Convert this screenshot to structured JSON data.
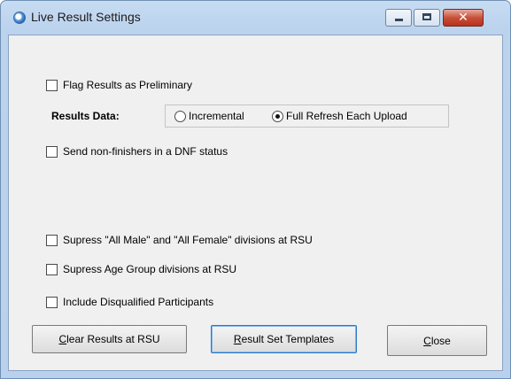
{
  "window": {
    "title": "Live Result Settings",
    "controls": {
      "minimize": "minimize",
      "maximize": "maximize",
      "close": "✕"
    }
  },
  "options": {
    "flag_preliminary": {
      "label": "Flag Results as Preliminary",
      "checked": false
    },
    "results_data": {
      "label": "Results Data:",
      "choices": [
        {
          "label": "Incremental",
          "selected": false
        },
        {
          "label": "Full Refresh Each Upload",
          "selected": true
        }
      ]
    },
    "send_dnf": {
      "label": "Send non-finishers in a DNF status",
      "checked": false
    },
    "suppress_all_male_female": {
      "label": "Supress \"All Male\" and \"All Female\" divisions at RSU",
      "checked": false
    },
    "suppress_age_group": {
      "label": "Supress Age Group divisions at RSU",
      "checked": false
    },
    "include_disqualified": {
      "label": "Include Disqualified Participants",
      "checked": false
    }
  },
  "buttons": {
    "clear_results": {
      "mnemonic": "C",
      "rest": "lear Results at RSU"
    },
    "result_set_templates": {
      "mnemonic": "R",
      "rest": "esult Set Templates"
    },
    "close": {
      "mnemonic": "C",
      "rest": "lose"
    }
  }
}
